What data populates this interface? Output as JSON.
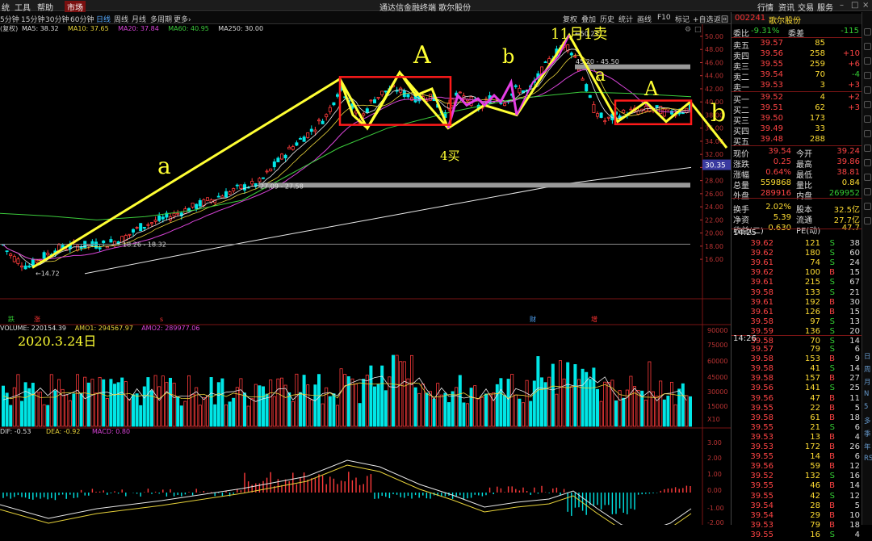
{
  "menu": {
    "left": [
      "统",
      "工具",
      "帮助"
    ],
    "market": "市场",
    "title": "通达信金融终端  歌尔股份",
    "right": [
      "行情",
      "资讯",
      "交易",
      "服务"
    ]
  },
  "periods": [
    "5分钟",
    "15分钟",
    "30分钟",
    "60分钟",
    "日线",
    "周线",
    "月线",
    "多周期",
    "更多›"
  ],
  "tools": [
    "复权",
    "叠加",
    "历史",
    "统计",
    "画线",
    "F10",
    "标记",
    "+自选",
    "返回"
  ],
  "indicators": {
    "ma": {
      "prefix": "(复权)",
      "items": [
        {
          "label": "MA5: 38.32",
          "color": "#dddddd"
        },
        {
          "label": "MA10: 37.65",
          "color": "#e7d23a"
        },
        {
          "label": "MA20: 37.84",
          "color": "#d844d8"
        },
        {
          "label": "MA60: 40.95",
          "color": "#3ccc3c"
        },
        {
          "label": "MA250: 30.00",
          "color": "#dddddd"
        }
      ]
    },
    "vol": {
      "items": [
        {
          "label": "VOLUME: 220154.39",
          "color": "#dddddd"
        },
        {
          "label": "AMO1: 294567.97",
          "color": "#e7d23a"
        },
        {
          "label": "AMO2: 289977.06",
          "color": "#d844d8"
        }
      ]
    },
    "macd": {
      "items": [
        {
          "label": "DIF: -0.53",
          "color": "#dddddd"
        },
        {
          "label": "DEA: -0.92",
          "color": "#e7d23a"
        },
        {
          "label": "MACD: 0.80",
          "color": "#d844d8"
        }
      ]
    }
  },
  "price_axis": [
    "50.00",
    "48.00",
    "46.00",
    "44.00",
    "42.00",
    "40.00",
    "38.00",
    "36.00",
    "34.00",
    "32.00",
    "30.00",
    "28.00",
    "26.00",
    "24.00",
    "22.00",
    "20.00",
    "18.00",
    "16.00"
  ],
  "vol_axis": [
    "90000",
    "75000",
    "60000",
    "45000",
    "30000",
    "15000",
    "X10"
  ],
  "macd_axis": [
    "3.00",
    "2.00",
    "1.00",
    "0.00",
    "-1.00",
    "-2.00"
  ],
  "current_price_tag": "30.35",
  "annotations": {
    "low": "14.72",
    "high": "50.21",
    "box1": "18.26 - 18.32",
    "box2": "27.09 - 27.58",
    "box3": "45.20 - 45.50",
    "handwritten": {
      "a1": "a",
      "A1": "A",
      "b1": "b",
      "date_top": "11月1卖",
      "a2": "a",
      "A2": "A",
      "b2": "b",
      "buy": "4买",
      "date_bottom": "2020.3.24日"
    },
    "markers": {
      "die": "跌",
      "zhang": "涨",
      "cai": "财",
      "zeng": "增",
      "s": "s"
    }
  },
  "chart_data": {
    "type": "candlestick",
    "symbol": "002241 歌尔股份",
    "price_range": [
      14,
      51
    ],
    "key_prices": [
      {
        "label": "low",
        "value": 14.72
      },
      {
        "label": "high",
        "value": 50.21
      },
      {
        "label": "box1",
        "value": [
          18.26,
          18.32
        ]
      },
      {
        "label": "box2",
        "value": [
          27.09,
          27.58
        ]
      },
      {
        "label": "box3",
        "value": [
          45.2,
          45.5
        ]
      }
    ],
    "wave_path_prices": [
      14.72,
      43.5,
      36,
      44.5,
      36,
      39.5,
      38,
      44,
      38.5,
      50.2,
      37,
      40,
      37,
      40,
      33
    ],
    "ma250_range": [
      13.8,
      30.0
    ],
    "ma60_range": [
      22,
      41.5
    ]
  },
  "quote": {
    "code": "002241",
    "name": "歌尔股份",
    "weibi": {
      "label": "委比",
      "value": "-9.31%",
      "label2": "委差",
      "value2": "-115"
    },
    "asks": [
      {
        "l": "卖五",
        "p": "39.57",
        "v": "85",
        "c": ""
      },
      {
        "l": "卖四",
        "p": "39.56",
        "v": "258",
        "c": "+10"
      },
      {
        "l": "卖三",
        "p": "39.55",
        "v": "259",
        "c": "+6"
      },
      {
        "l": "卖二",
        "p": "39.54",
        "v": "70",
        "c": "-4"
      },
      {
        "l": "卖一",
        "p": "39.53",
        "v": "3",
        "c": "+3"
      }
    ],
    "bids": [
      {
        "l": "买一",
        "p": "39.52",
        "v": "4",
        "c": "+2"
      },
      {
        "l": "买二",
        "p": "39.51",
        "v": "62",
        "c": "+3"
      },
      {
        "l": "买三",
        "p": "39.50",
        "v": "173",
        "c": ""
      },
      {
        "l": "买四",
        "p": "39.49",
        "v": "33",
        "c": ""
      },
      {
        "l": "买五",
        "p": "39.48",
        "v": "288",
        "c": ""
      }
    ],
    "stats": [
      {
        "l1": "现价",
        "v1": "39.54",
        "l2": "今开",
        "v2": "39.24"
      },
      {
        "l1": "涨跌",
        "v1": "0.25",
        "l2": "最高",
        "v2": "39.86"
      },
      {
        "l1": "涨幅",
        "v1": "0.64%",
        "l2": "最低",
        "v2": "38.81"
      },
      {
        "l1": "总量",
        "v1": "559868",
        "l2": "量比",
        "v2": "0.84"
      },
      {
        "l1": "外盘",
        "v1": "289916",
        "l2": "内盘",
        "v2": "269952"
      },
      {
        "l1": "换手",
        "v1": "2.02%",
        "l2": "股本",
        "v2": "32.5亿"
      },
      {
        "l1": "净资",
        "v1": "5.39",
        "l2": "流通",
        "v2": "27.7亿"
      },
      {
        "l1": "收益(二)",
        "v1": "0.630",
        "l2": "PE(动)",
        "v2": "47.7"
      }
    ],
    "ticks1_time": "14:25",
    "ticks1": [
      [
        "39.62",
        "121",
        "S",
        "38"
      ],
      [
        "39.62",
        "180",
        "S",
        "60"
      ],
      [
        "39.61",
        "74",
        "S",
        "24"
      ],
      [
        "39.62",
        "100",
        "B",
        "15"
      ],
      [
        "39.61",
        "215",
        "S",
        "67"
      ],
      [
        "39.58",
        "133",
        "S",
        "21"
      ],
      [
        "39.61",
        "192",
        "B",
        "30"
      ],
      [
        "39.61",
        "126",
        "B",
        "15"
      ],
      [
        "39.58",
        "97",
        "S",
        "13"
      ],
      [
        "39.59",
        "136",
        "S",
        "20"
      ],
      [
        "39.58",
        "70",
        "S",
        "14"
      ]
    ],
    "ticks2_time": "14:26",
    "ticks2": [
      [
        "39.57",
        "79",
        "S",
        "6"
      ],
      [
        "39.58",
        "153",
        "B",
        "9"
      ],
      [
        "39.58",
        "41",
        "S",
        "14"
      ],
      [
        "39.58",
        "157",
        "B",
        "27"
      ],
      [
        "39.56",
        "141",
        "S",
        "25"
      ],
      [
        "39.56",
        "47",
        "B",
        "11"
      ],
      [
        "39.55",
        "22",
        "B",
        "5"
      ],
      [
        "39.58",
        "61",
        "B",
        "18"
      ],
      [
        "39.55",
        "21",
        "S",
        "6"
      ],
      [
        "39.53",
        "13",
        "B",
        "4"
      ],
      [
        "39.53",
        "172",
        "B",
        "26"
      ],
      [
        "39.55",
        "14",
        "B",
        "6"
      ],
      [
        "39.56",
        "59",
        "B",
        "12"
      ],
      [
        "39.52",
        "132",
        "S",
        "16"
      ],
      [
        "39.55",
        "46",
        "B",
        "14"
      ],
      [
        "39.55",
        "42",
        "S",
        "12"
      ],
      [
        "39.54",
        "28",
        "B",
        "5"
      ],
      [
        "39.54",
        "29",
        "B",
        "10"
      ],
      [
        "39.53",
        "79",
        "B",
        "18"
      ],
      [
        "39.55",
        "16",
        "S",
        "4"
      ]
    ]
  },
  "right_sidebar": [
    "日",
    "周",
    "月",
    "N",
    "5",
    "多",
    "季",
    "年",
    "RSI"
  ],
  "colors": {
    "up": "#ff3b3b",
    "down": "#00e6e6",
    "annot_yellow": "#ffff33",
    "box_red": "#ff1a1a",
    "ma_white": "#e8e8e8",
    "ma_yellow": "#e7d23a",
    "ma_purple": "#d844d8",
    "ma_green": "#3ccc3c"
  }
}
